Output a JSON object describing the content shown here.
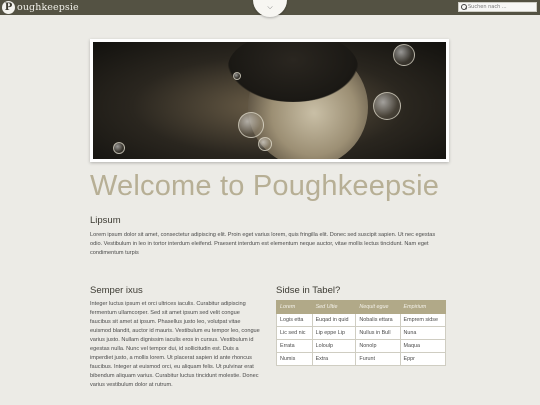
{
  "header": {
    "logo_letter": "P",
    "logo_text": "oughkeepsie",
    "menu_glyph": "⌵",
    "search_placeholder": "Suchen nach ..."
  },
  "welcome": "Welcome to Poughkeepsie",
  "section1": {
    "title": "Lipsum",
    "text": "Lorem ipsum dolor sit amet, consectetur adipiscing elit. Proin eget varius lorem, quis fringilla elit. Donec sed suscipit sapien. Ut nec egestas odio. Vestibulum in leo in tortor interdum eleifend. Praesent interdum est elementum neque auctor, vitae mollis lectus tincidunt. Nam eget condimentum turpis"
  },
  "section2": {
    "title": "Semper ixus",
    "text": "Integer luctus ipsum et orci ultrices iaculis. Curabitur adipiscing fermentum ullamcorper. Sed sit amet ipsum sed velit congue faucibus sit amet at ipsum. Phasellus justo leo, volutpat vitae euismod blandit, auctor id mauris. Vestibulum eu tempor leo, congue varius justo. Nullam dignissim iaculis eros in cursus. Vestibulum id egestas nulla. Nunc vel tempor dui, id sollicitudin est. Duis a imperdiet justo, a mollis lorem. Ut placerat sapien id ante rhoncus faucibus. Integer at euismod orci, eu aliquam felis. Ut pulvinar erat bibendum aliquam varius. Curabitur luctus tincidunt molestie. Donec varius vestibulum dolor at rutrum."
  },
  "section3": {
    "title": "Sidse in Tabel?",
    "headers": [
      "Lorem",
      "Sed Ultie",
      "Nequit egue",
      "Empirium"
    ],
    "rows": [
      [
        "Logis etta",
        "Euqad in quid",
        "Nobalis ettara",
        "Emprem sidse"
      ],
      [
        "Lic sed nic",
        "Lip eppe Lip",
        "Nullus in Bull",
        "Nuna"
      ],
      [
        "Errata",
        "Loloulp",
        "Nonolp",
        "Maqua"
      ],
      [
        "Numis",
        "Extra",
        "Furunt",
        "Eppr"
      ]
    ]
  },
  "colors": {
    "topbar": "#545243",
    "accent_title": "#b7af95",
    "table_header": "#b1a988",
    "page_bg": "#ecebe6"
  }
}
